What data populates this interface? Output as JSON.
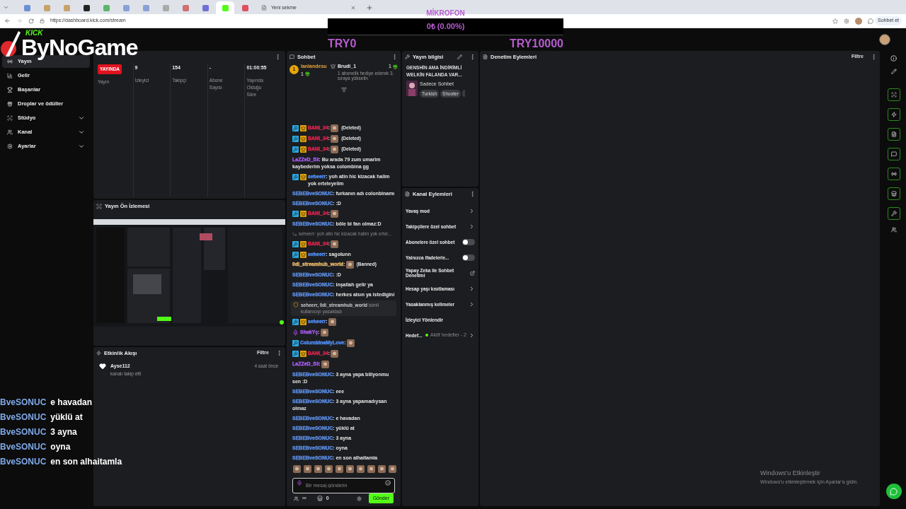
{
  "browser": {
    "tabs": [
      {
        "selected": false
      },
      {
        "selected": false
      },
      {
        "selected": false
      },
      {
        "selected": false
      },
      {
        "selected": false
      },
      {
        "selected": false
      },
      {
        "selected": false
      },
      {
        "selected": false
      },
      {
        "selected": false
      },
      {
        "selected": false
      },
      {
        "selected": true
      },
      {
        "selected": false
      },
      {
        "title": "Yeni sekme",
        "selected": false
      }
    ],
    "url": "https://dashboard.kick.com/stream",
    "chat_button": "Sohbet et"
  },
  "overlay": {
    "logo_small": "KICK",
    "logo": "ByNoGame",
    "goal_label": "MİKROFON",
    "goal_amount": "0₺ (0.00%)",
    "goal_min": "TRY0",
    "goal_max": "TRY10000",
    "chat": [
      {
        "user": "BveSONUC",
        "text": "e havadan"
      },
      {
        "user": "BveSONUC",
        "text": "yüklü at"
      },
      {
        "user": "BveSONUC",
        "text": "3 ayna"
      },
      {
        "user": "BveSONUC",
        "text": "oyna"
      },
      {
        "user": "BveSONUC",
        "text": "en son alhaitamla"
      }
    ]
  },
  "sidebar": {
    "items": [
      {
        "label": "Yayın",
        "kind": "link",
        "selected": true
      },
      {
        "label": "Gelir",
        "kind": "link",
        "selected": false
      },
      {
        "label": "Başarılar",
        "kind": "link",
        "selected": false
      },
      {
        "label": "Droplar ve ödüller",
        "kind": "link",
        "selected": false
      },
      {
        "label": "Stüdyo",
        "kind": "group",
        "selected": false
      },
      {
        "label": "Kanal",
        "kind": "group",
        "selected": false
      },
      {
        "label": "Ayarlar",
        "kind": "group",
        "selected": false
      }
    ]
  },
  "stats": [
    {
      "kind": "badge",
      "value": "YAYINDA",
      "label": "Yayın"
    },
    {
      "kind": "number",
      "value": "9",
      "label": "İzleyici"
    },
    {
      "kind": "number",
      "value": "154",
      "label": "Takipçi"
    },
    {
      "kind": "number",
      "value": "-",
      "label": "Abone Sayısı"
    },
    {
      "kind": "number",
      "value": "01:00:55",
      "label": "Yayında Olduğu Süre"
    }
  ],
  "preview": {
    "title": "Yayın Ön İzlemesi"
  },
  "activity": {
    "title": "Etkinlik Akışı",
    "filter": "Filtre",
    "events": [
      {
        "user": "Ayse112",
        "action": "kanalı takip etti",
        "time": "4 saat önce"
      }
    ]
  },
  "chat": {
    "title": "Sohbet",
    "leaders": [
      {
        "rank": "1",
        "name": "lanlandesu",
        "count": "1"
      },
      {
        "name": "Brudi_1",
        "count": "1",
        "hint": "1 abonelik hediye ederek 3. sıraya yükselin"
      }
    ],
    "messages": [
      {
        "kind": "message",
        "user": "BANI_34",
        "color": "#e0234e",
        "mod": true,
        "vip": true,
        "sub": false,
        "text": ":",
        "emote": true,
        "tag": "(Deleted)"
      },
      {
        "kind": "message",
        "user": "BANI_34",
        "color": "#e0234e",
        "mod": true,
        "vip": true,
        "sub": false,
        "text": ":",
        "emote": true,
        "tag": "(Deleted)"
      },
      {
        "kind": "message",
        "user": "BANI_34",
        "color": "#e0234e",
        "mod": true,
        "vip": true,
        "sub": false,
        "text": ":",
        "emote": true,
        "tag": "(Deleted)"
      },
      {
        "kind": "message",
        "user": "LaZZeD_53",
        "color": "#a45cf0",
        "mod": false,
        "vip": false,
        "sub": false,
        "text": ": Bu arada 79 zum umarim kaybederim yoksa colombina gg",
        "emote": false
      },
      {
        "kind": "message",
        "user": "seheerr",
        "color": "#4f8df5",
        "mod": true,
        "vip": true,
        "sub": false,
        "text": ": yoh atin hic kizacak halim yok erteleyelim",
        "emote": false
      },
      {
        "kind": "message",
        "user": "SEBEBveSONUC",
        "color": "#5b8ee6",
        "mod": false,
        "vip": false,
        "sub": false,
        "text": ": furkanın adı colonbinamı",
        "emote": false
      },
      {
        "kind": "message",
        "user": "SEBEBveSONUC",
        "color": "#5b8ee6",
        "mod": false,
        "vip": false,
        "sub": false,
        "text": ": :D",
        "emote": false
      },
      {
        "kind": "message",
        "user": "BANI_34",
        "color": "#e0234e",
        "mod": true,
        "vip": true,
        "sub": false,
        "text": ":",
        "emote": true
      },
      {
        "kind": "message",
        "user": "SEBEBveSONUC",
        "color": "#5b8ee6",
        "mod": false,
        "vip": false,
        "sub": false,
        "text": ": böle bi fan olmaz:D",
        "emote": false
      },
      {
        "kind": "reply",
        "text": "seheerr: yoh atin hic kizacak halim yok ertel..."
      },
      {
        "kind": "message",
        "user": "BANI_34",
        "color": "#e0234e",
        "mod": true,
        "vip": true,
        "sub": false,
        "text": ":",
        "emote": true
      },
      {
        "kind": "message",
        "user": "seheerr",
        "color": "#4f8df5",
        "mod": true,
        "vip": true,
        "sub": false,
        "text": ": sagolunn",
        "emote": false
      },
      {
        "kind": "message",
        "user": "0di_streamhub_world",
        "color": "#e8b86a",
        "mod": false,
        "vip": false,
        "sub": false,
        "text": ":",
        "emote": true,
        "tag": "(Banned)"
      },
      {
        "kind": "message",
        "user": "SEBEBveSONUC",
        "color": "#5b8ee6",
        "mod": false,
        "vip": false,
        "sub": false,
        "text": ": :D",
        "emote": false
      },
      {
        "kind": "message",
        "user": "SEBEBveSONUC",
        "color": "#5b8ee6",
        "mod": false,
        "vip": false,
        "sub": false,
        "text": ": inşallah gelir ya",
        "emote": false
      },
      {
        "kind": "message",
        "user": "SEBEBveSONUC",
        "color": "#5b8ee6",
        "mod": false,
        "vip": false,
        "sub": false,
        "text": ": herkes alsın ya istedigini",
        "emote": false
      },
      {
        "kind": "system",
        "text": "**seheerr, 0di_streamhub_world** isimli kullanıcıyı yasakladı"
      },
      {
        "kind": "message",
        "user": "seheerr",
        "color": "#4f8df5",
        "mod": true,
        "vip": true,
        "sub": false,
        "text": ":",
        "emote": true
      },
      {
        "kind": "message",
        "user": "ShakYç",
        "color": "#a45cf0",
        "mod": false,
        "vip": false,
        "sub": true,
        "text": ":",
        "emote": true
      },
      {
        "kind": "message",
        "user": "ColumbinaMyLove",
        "color": "#4f8df5",
        "mod": true,
        "vip": false,
        "sub": false,
        "text": ":",
        "emote": true
      },
      {
        "kind": "message",
        "user": "BANI_34",
        "color": "#e0234e",
        "mod": true,
        "vip": true,
        "sub": false,
        "text": ":",
        "emote": true
      },
      {
        "kind": "message",
        "user": "LaZZeD_53",
        "color": "#a45cf0",
        "mod": false,
        "vip": false,
        "sub": false,
        "text": ":",
        "emote": true
      },
      {
        "kind": "message",
        "user": "SEBEBveSONUC",
        "color": "#5b8ee6",
        "mod": false,
        "vip": false,
        "sub": false,
        "text": ": 3 ayna yapa biliyonmu sen :D",
        "emote": false
      },
      {
        "kind": "message",
        "user": "SEBEBveSONUC",
        "color": "#5b8ee6",
        "mod": false,
        "vip": false,
        "sub": false,
        "text": ": eee",
        "emote": false
      },
      {
        "kind": "message",
        "user": "SEBEBveSONUC",
        "color": "#5b8ee6",
        "mod": false,
        "vip": false,
        "sub": false,
        "text": ": 3 ayna yapamadıysan olmaz",
        "emote": false
      },
      {
        "kind": "message",
        "user": "SEBEBveSONUC",
        "color": "#5b8ee6",
        "mod": false,
        "vip": false,
        "sub": false,
        "text": ": e havadan",
        "emote": false
      },
      {
        "kind": "message",
        "user": "SEBEBveSONUC",
        "color": "#5b8ee6",
        "mod": false,
        "vip": false,
        "sub": false,
        "text": ": yüklü at",
        "emote": false
      },
      {
        "kind": "message",
        "user": "SEBEBveSONUC",
        "color": "#5b8ee6",
        "mod": false,
        "vip": false,
        "sub": false,
        "text": ": 3 ayna",
        "emote": false
      },
      {
        "kind": "message",
        "user": "SEBEBveSONUC",
        "color": "#5b8ee6",
        "mod": false,
        "vip": false,
        "sub": false,
        "text": ": oyna",
        "emote": false
      },
      {
        "kind": "message",
        "user": "SEBEBveSONUC",
        "color": "#5b8ee6",
        "mod": false,
        "vip": false,
        "sub": false,
        "text": ": en son alhaitamla",
        "emote": false
      }
    ],
    "input": {
      "placeholder": "Bir mesaj gönderin"
    },
    "points": "∞",
    "gifts": "0",
    "send": "Gönder"
  },
  "stream_info": {
    "title": "Yayın bilgisi",
    "stream_title": "GENSHİN AMA İNDİRİMLİ WELKİN FALANDA VAR...",
    "category": "Sadece Sohbet",
    "tags": [
      "Turkish",
      "Shooter"
    ]
  },
  "channel_actions": {
    "title": "Kanal Eylemleri",
    "items": [
      {
        "kind": "link",
        "label": "Yavaş mod"
      },
      {
        "kind": "link",
        "label": "Takipçilere özel sohbet"
      },
      {
        "kind": "toggle",
        "label": "Abonelere özel sohbet",
        "on": false
      },
      {
        "kind": "toggle",
        "label": "Yalnızca ifadelerle...",
        "on": false
      },
      {
        "kind": "external",
        "label": "Yapay Zeka ile Sohbet Denetimi"
      },
      {
        "kind": "link",
        "label": "Hesap yaşı kısıtlaması"
      },
      {
        "kind": "link",
        "label": "Yasaklanmış kelimeler"
      },
      {
        "kind": "plain",
        "label": "İzleyici Yönlendir"
      },
      {
        "kind": "goal",
        "label": "Hedef...",
        "status": "Aktif hedefler - 2"
      }
    ]
  },
  "moderation": {
    "title": "Denetim Eylemleri",
    "filter": "Filtre"
  },
  "watermark": {
    "title": "Windows'u Etkinleştir",
    "subtitle": "Windows'u etkinleştirmek için Ayarlar'a gidin."
  }
}
